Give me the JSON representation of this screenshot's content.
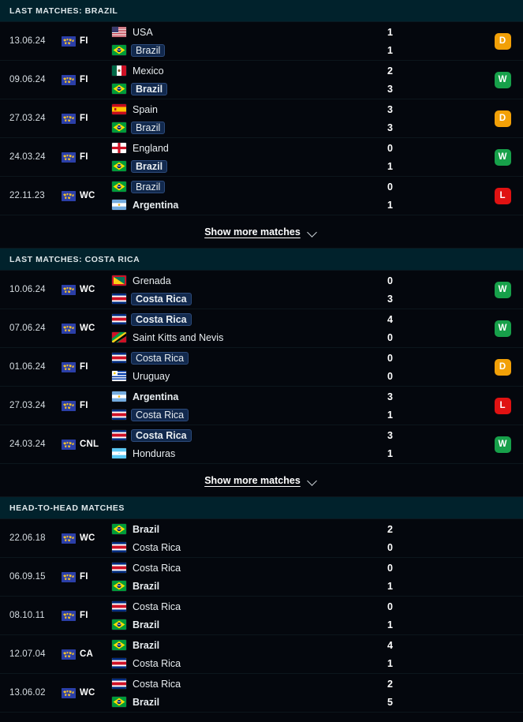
{
  "theme": {
    "bg": "#04070d",
    "header_bg": "#01222c",
    "highlight_bg": "#12294d",
    "win_color": "#17a04a",
    "draw_color": "#f2a007",
    "loss_color": "#e01212"
  },
  "show_more": {
    "label": "Show more matches",
    "icon": "chevron-down-icon"
  },
  "sections": [
    {
      "id": "last-matches-brazil",
      "title": "LAST MATCHES: BRAZIL",
      "has_result_column": true,
      "has_show_more": true,
      "matches": [
        {
          "date": "13.06.24",
          "competition": "FI",
          "competition_icon": "world-map-icon",
          "result": "D",
          "home": {
            "team": "USA",
            "flag": "us",
            "score": "1",
            "bold": false,
            "highlight": false
          },
          "away": {
            "team": "Brazil",
            "flag": "br",
            "score": "1",
            "bold": false,
            "highlight": true
          }
        },
        {
          "date": "09.06.24",
          "competition": "FI",
          "competition_icon": "world-map-icon",
          "result": "W",
          "home": {
            "team": "Mexico",
            "flag": "mx",
            "score": "2",
            "bold": false,
            "highlight": false
          },
          "away": {
            "team": "Brazil",
            "flag": "br",
            "score": "3",
            "bold": true,
            "highlight": true
          }
        },
        {
          "date": "27.03.24",
          "competition": "FI",
          "competition_icon": "world-map-icon",
          "result": "D",
          "home": {
            "team": "Spain",
            "flag": "es",
            "score": "3",
            "bold": false,
            "highlight": false
          },
          "away": {
            "team": "Brazil",
            "flag": "br",
            "score": "3",
            "bold": false,
            "highlight": true
          }
        },
        {
          "date": "24.03.24",
          "competition": "FI",
          "competition_icon": "world-map-icon",
          "result": "W",
          "home": {
            "team": "England",
            "flag": "gb-eng",
            "score": "0",
            "bold": false,
            "highlight": false
          },
          "away": {
            "team": "Brazil",
            "flag": "br",
            "score": "1",
            "bold": true,
            "highlight": true
          }
        },
        {
          "date": "22.11.23",
          "competition": "WC",
          "competition_icon": "world-map-icon",
          "result": "L",
          "home": {
            "team": "Brazil",
            "flag": "br",
            "score": "0",
            "bold": false,
            "highlight": true
          },
          "away": {
            "team": "Argentina",
            "flag": "ar",
            "score": "1",
            "bold": true,
            "highlight": false
          }
        }
      ]
    },
    {
      "id": "last-matches-costa-rica",
      "title": "LAST MATCHES: COSTA RICA",
      "has_result_column": true,
      "has_show_more": true,
      "matches": [
        {
          "date": "10.06.24",
          "competition": "WC",
          "competition_icon": "world-map-icon",
          "result": "W",
          "home": {
            "team": "Grenada",
            "flag": "gd",
            "score": "0",
            "bold": false,
            "highlight": false
          },
          "away": {
            "team": "Costa Rica",
            "flag": "cr",
            "score": "3",
            "bold": true,
            "highlight": true
          }
        },
        {
          "date": "07.06.24",
          "competition": "WC",
          "competition_icon": "world-map-icon",
          "result": "W",
          "home": {
            "team": "Costa Rica",
            "flag": "cr",
            "score": "4",
            "bold": true,
            "highlight": true
          },
          "away": {
            "team": "Saint Kitts and Nevis",
            "flag": "kn",
            "score": "0",
            "bold": false,
            "highlight": false
          }
        },
        {
          "date": "01.06.24",
          "competition": "FI",
          "competition_icon": "world-map-icon",
          "result": "D",
          "home": {
            "team": "Costa Rica",
            "flag": "cr",
            "score": "0",
            "bold": false,
            "highlight": true
          },
          "away": {
            "team": "Uruguay",
            "flag": "uy",
            "score": "0",
            "bold": false,
            "highlight": false
          }
        },
        {
          "date": "27.03.24",
          "competition": "FI",
          "competition_icon": "world-map-icon",
          "result": "L",
          "home": {
            "team": "Argentina",
            "flag": "ar",
            "score": "3",
            "bold": true,
            "highlight": false
          },
          "away": {
            "team": "Costa Rica",
            "flag": "cr",
            "score": "1",
            "bold": false,
            "highlight": true
          }
        },
        {
          "date": "24.03.24",
          "competition": "CNL",
          "competition_icon": "world-map-icon",
          "result": "W",
          "home": {
            "team": "Costa Rica",
            "flag": "cr",
            "score": "3",
            "bold": true,
            "highlight": true
          },
          "away": {
            "team": "Honduras",
            "flag": "hn",
            "score": "1",
            "bold": false,
            "highlight": false
          }
        }
      ]
    },
    {
      "id": "head-to-head-matches",
      "title": "HEAD-TO-HEAD MATCHES",
      "has_result_column": false,
      "has_show_more": false,
      "matches": [
        {
          "date": "22.06.18",
          "competition": "WC",
          "competition_icon": "world-map-icon",
          "result": "",
          "home": {
            "team": "Brazil",
            "flag": "br",
            "score": "2",
            "bold": true,
            "highlight": false
          },
          "away": {
            "team": "Costa Rica",
            "flag": "cr",
            "score": "0",
            "bold": false,
            "highlight": false
          }
        },
        {
          "date": "06.09.15",
          "competition": "FI",
          "competition_icon": "world-map-icon",
          "result": "",
          "home": {
            "team": "Costa Rica",
            "flag": "cr",
            "score": "0",
            "bold": false,
            "highlight": false
          },
          "away": {
            "team": "Brazil",
            "flag": "br",
            "score": "1",
            "bold": true,
            "highlight": false
          }
        },
        {
          "date": "08.10.11",
          "competition": "FI",
          "competition_icon": "world-map-icon",
          "result": "",
          "home": {
            "team": "Costa Rica",
            "flag": "cr",
            "score": "0",
            "bold": false,
            "highlight": false
          },
          "away": {
            "team": "Brazil",
            "flag": "br",
            "score": "1",
            "bold": true,
            "highlight": false
          }
        },
        {
          "date": "12.07.04",
          "competition": "CA",
          "competition_icon": "world-map-icon",
          "result": "",
          "home": {
            "team": "Brazil",
            "flag": "br",
            "score": "4",
            "bold": true,
            "highlight": false
          },
          "away": {
            "team": "Costa Rica",
            "flag": "cr",
            "score": "1",
            "bold": false,
            "highlight": false
          }
        },
        {
          "date": "13.06.02",
          "competition": "WC",
          "competition_icon": "world-map-icon",
          "result": "",
          "home": {
            "team": "Costa Rica",
            "flag": "cr",
            "score": "2",
            "bold": false,
            "highlight": false
          },
          "away": {
            "team": "Brazil",
            "flag": "br",
            "score": "5",
            "bold": true,
            "highlight": false
          }
        }
      ]
    }
  ]
}
